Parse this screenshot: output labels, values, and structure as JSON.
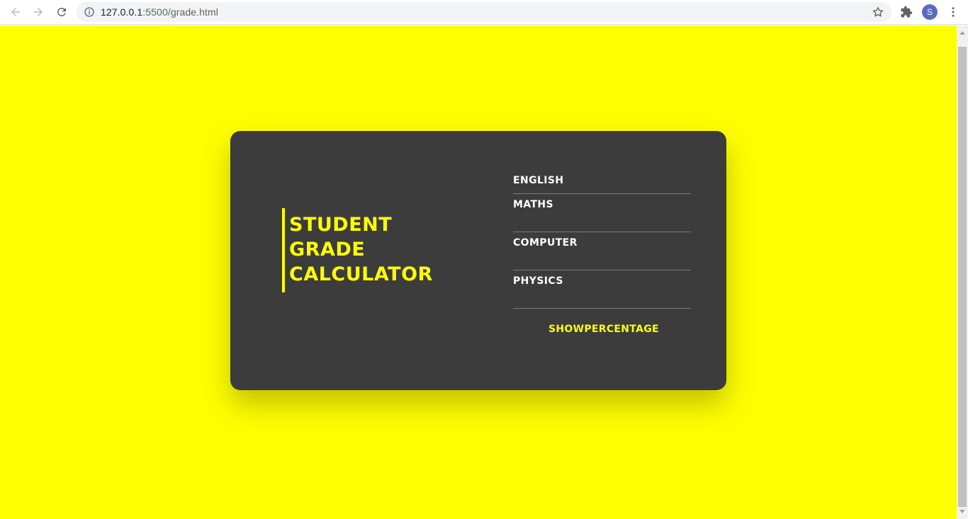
{
  "browser": {
    "url_host": "127.0.0.1",
    "url_path": ":5500/grade.html",
    "avatar_letter": "S"
  },
  "page": {
    "background_color": "#ffff00",
    "title_lines": [
      "STUDENT",
      "GRADE",
      "CALCULATOR"
    ],
    "fields": [
      {
        "label": "ENGLISH",
        "value": ""
      },
      {
        "label": "MATHS",
        "value": ""
      },
      {
        "label": "COMPUTER",
        "value": ""
      },
      {
        "label": "PHYSICS",
        "value": ""
      }
    ],
    "submit_label": "SHOWPERCENTAGE"
  },
  "colors": {
    "accent": "#ffff00",
    "card": "#3c3c3c",
    "label": "#ffffff"
  }
}
